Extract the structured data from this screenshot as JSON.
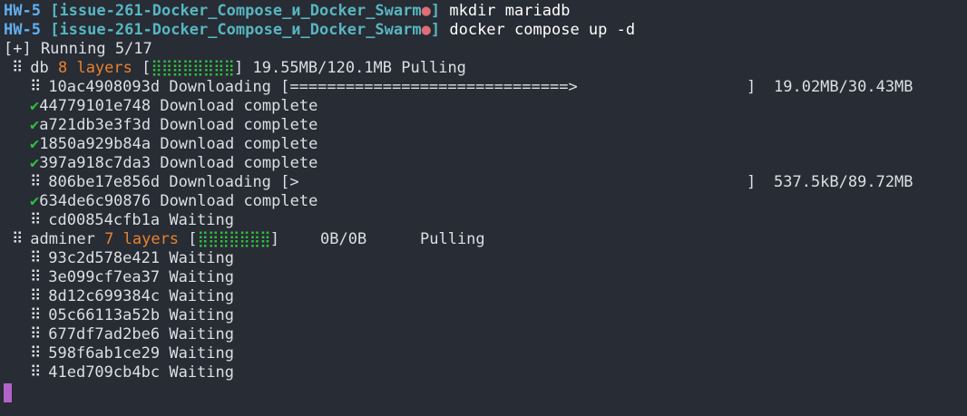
{
  "prompt": {
    "host": "HW-5",
    "branch": "[issue-261-Docker_Compose_и_Docker_Swarm",
    "dot": "●",
    "branch_close": "]"
  },
  "commands": [
    {
      "cmd": "mkdir",
      "args": "mariadb"
    },
    {
      "cmd": "docker",
      "args": "compose up -d"
    }
  ],
  "status": "[+] Running 5/17",
  "spinner_glyph": "⠿",
  "check_glyph": "✔",
  "db": {
    "name": "db",
    "layers": "8 layers",
    "bar_open": "[",
    "bar_fill": "⣿⣿⣿⣿⣿⣿⣿⣿",
    "bar_close": "]",
    "progress": "19.55MB/120.1MB",
    "state": "Pulling",
    "items": [
      {
        "icon": "spinner",
        "id": "10ac4908093d",
        "status": "Downloading",
        "bar": "[==============================>",
        "bar_end": "]",
        "size": "19.02MB/30.43MB"
      },
      {
        "icon": "check",
        "id": "44779101e748",
        "status": "Download complete"
      },
      {
        "icon": "check",
        "id": "a721db3e3f3d",
        "status": "Download complete"
      },
      {
        "icon": "check",
        "id": "1850a929b84a",
        "status": "Download complete"
      },
      {
        "icon": "check",
        "id": "397a918c7da3",
        "status": "Download complete"
      },
      {
        "icon": "spinner",
        "id": "806be17e856d",
        "status": "Downloading",
        "bar": "[>",
        "bar_end": "]",
        "size": "537.5kB/89.72MB"
      },
      {
        "icon": "check",
        "id": "634de6c90876",
        "status": "Download complete"
      },
      {
        "icon": "spinner",
        "id": "cd00854cfb1a",
        "status": "Waiting"
      }
    ]
  },
  "adminer": {
    "name": "adminer",
    "layers": "7 layers",
    "bar_open": "[",
    "bar_fill": "⣿⣿⣿⣿⣿⣿⣿",
    "bar_close": "]",
    "progress": "0B/0B",
    "state": "Pulling",
    "items": [
      {
        "icon": "spinner",
        "id": "93c2d578e421",
        "status": "Waiting"
      },
      {
        "icon": "spinner",
        "id": "3e099cf7ea37",
        "status": "Waiting"
      },
      {
        "icon": "spinner",
        "id": "8d12c699384c",
        "status": "Waiting"
      },
      {
        "icon": "spinner",
        "id": "05c66113a52b",
        "status": "Waiting"
      },
      {
        "icon": "spinner",
        "id": "677df7ad2be6",
        "status": "Waiting"
      },
      {
        "icon": "spinner",
        "id": "598f6ab1ce29",
        "status": "Waiting"
      },
      {
        "icon": "spinner",
        "id": "41ed709cb4bc",
        "status": "Waiting"
      }
    ]
  },
  "colors": {
    "background": "#282c34",
    "host": "#61afef",
    "branch": "#56b6c2",
    "dot": "#e06c75",
    "orange": "#e8832e",
    "green": "#2fbf3f",
    "cursor": "#b163c9"
  }
}
